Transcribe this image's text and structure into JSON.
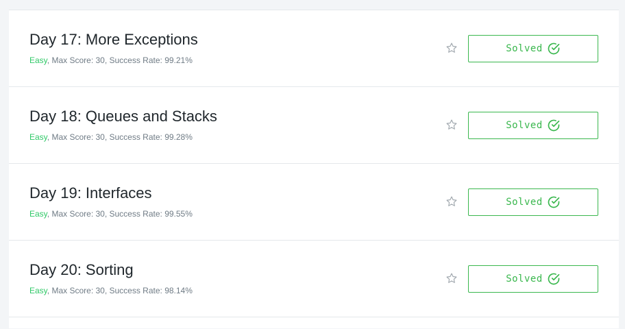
{
  "challenges": [
    {
      "title": "Day 17: More Exceptions",
      "difficulty": "Easy",
      "details": ", Max Score: 30, Success Rate: 99.21%",
      "button_label": "Solved",
      "star_icon": "star-outline-icon",
      "check_icon": "check-circle-icon"
    },
    {
      "title": "Day 18: Queues and Stacks",
      "difficulty": "Easy",
      "details": ", Max Score: 30, Success Rate: 99.28%",
      "button_label": "Solved",
      "star_icon": "star-outline-icon",
      "check_icon": "check-circle-icon"
    },
    {
      "title": "Day 19: Interfaces",
      "difficulty": "Easy",
      "details": ", Max Score: 30, Success Rate: 99.55%",
      "button_label": "Solved",
      "star_icon": "star-outline-icon",
      "check_icon": "check-circle-icon"
    },
    {
      "title": "Day 20: Sorting",
      "difficulty": "Easy",
      "details": ", Max Score: 30, Success Rate: 98.14%",
      "button_label": "Solved",
      "star_icon": "star-outline-icon",
      "check_icon": "check-circle-icon"
    }
  ],
  "colors": {
    "accent_green": "#39b74d",
    "difficulty_easy": "#2ec866",
    "title_text": "#1f262b",
    "meta_text": "#6f7b85",
    "page_background": "#f3f5f7"
  }
}
